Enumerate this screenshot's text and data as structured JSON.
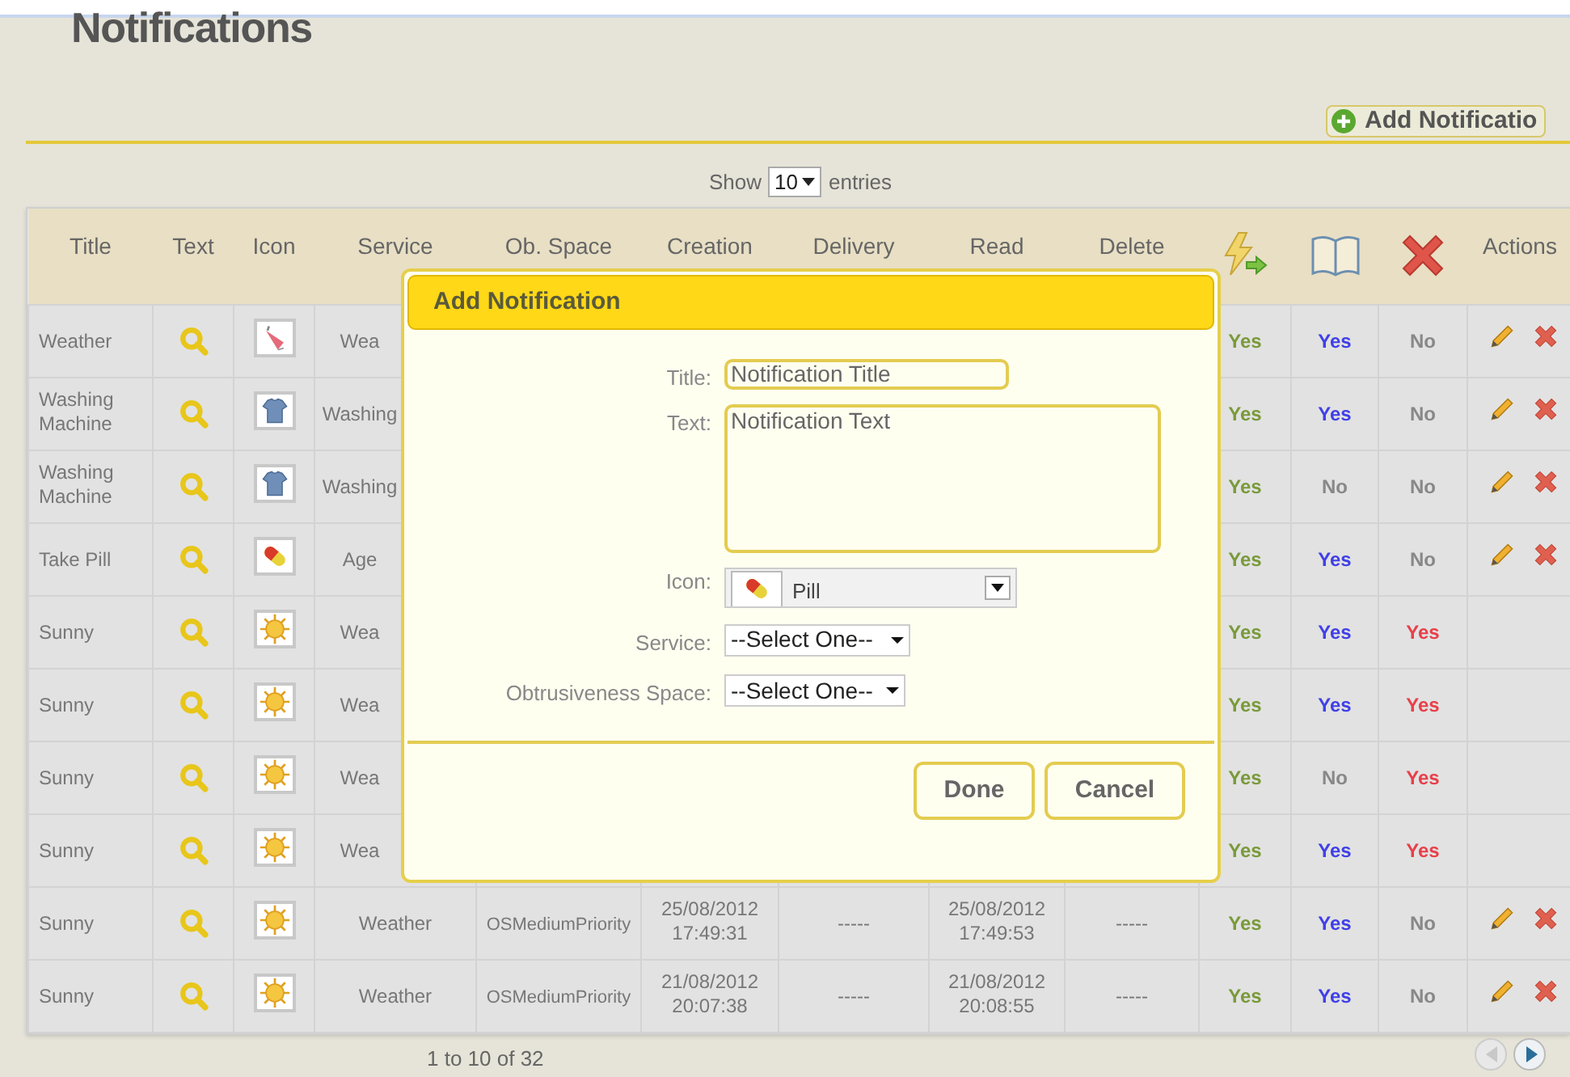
{
  "page_title": "Notifications",
  "add_button": "Add Notificatio",
  "length_menu": {
    "before": "Show",
    "value": "10",
    "after": "entries"
  },
  "table": {
    "columns": [
      {
        "kind": "text",
        "label": "Title"
      },
      {
        "kind": "text",
        "label": "Text"
      },
      {
        "kind": "text",
        "label": "Icon"
      },
      {
        "kind": "text",
        "label": "Service"
      },
      {
        "kind": "text",
        "label": "Ob. Space"
      },
      {
        "kind": "text",
        "label": "Creation"
      },
      {
        "kind": "text",
        "label": "Delivery"
      },
      {
        "kind": "text",
        "label": "Read"
      },
      {
        "kind": "text",
        "label": "Delete"
      },
      {
        "kind": "bolt"
      },
      {
        "kind": "book"
      },
      {
        "kind": "cross"
      },
      {
        "kind": "text",
        "label": "Actions"
      }
    ],
    "rows": [
      {
        "title": "Weather",
        "kind": "umbrella",
        "service": "Wea",
        "delivered": "Yes",
        "read": {
          "text": "Yes",
          "on": true
        },
        "deleted": {
          "text": "No",
          "on": false
        },
        "actions": true
      },
      {
        "title": "Washing Machine",
        "kind": "shirt",
        "service": "Washing",
        "delivered": "Yes",
        "read": {
          "text": "Yes",
          "on": true
        },
        "deleted": {
          "text": "No",
          "on": false
        },
        "actions": true
      },
      {
        "title": "Washing Machine",
        "kind": "shirt",
        "service": "Washing",
        "delivered": "Yes",
        "read": {
          "text": "No",
          "on": false
        },
        "deleted": {
          "text": "No",
          "on": false
        },
        "actions": true
      },
      {
        "title": "Take Pill",
        "kind": "pill",
        "service": "Age",
        "delivered": "Yes",
        "read": {
          "text": "Yes",
          "on": true
        },
        "deleted": {
          "text": "No",
          "on": false
        },
        "actions": true
      },
      {
        "title": "Sunny",
        "kind": "sun",
        "service": "Wea",
        "delivered": "Yes",
        "read": {
          "text": "Yes",
          "on": true
        },
        "deleted": {
          "text": "Yes",
          "on": true
        },
        "actions": false
      },
      {
        "title": "Sunny",
        "kind": "sun",
        "service": "Wea",
        "delivered": "Yes",
        "read": {
          "text": "Yes",
          "on": true
        },
        "deleted": {
          "text": "Yes",
          "on": true
        },
        "actions": false
      },
      {
        "title": "Sunny",
        "kind": "sun",
        "service": "Wea",
        "delivered": "Yes",
        "read": {
          "text": "No",
          "on": false
        },
        "deleted": {
          "text": "Yes",
          "on": true
        },
        "actions": false
      },
      {
        "title": "Sunny",
        "kind": "sun",
        "service": "Wea",
        "delivered": "Yes",
        "read": {
          "text": "Yes",
          "on": true
        },
        "deleted": {
          "text": "Yes",
          "on": true
        },
        "actions": false
      },
      {
        "title": "Sunny",
        "kind": "sun",
        "service": "Weather",
        "ob_space": "OSMediumPriority",
        "creation": "25/08/2012 17:49:31",
        "delivery": "-----",
        "read_date": "25/08/2012 17:49:53",
        "delete_date": "-----",
        "delivered": "Yes",
        "read": {
          "text": "Yes",
          "on": true
        },
        "deleted": {
          "text": "No",
          "on": false
        },
        "actions": true
      },
      {
        "title": "Sunny",
        "kind": "sun",
        "service": "Weather",
        "ob_space": "OSMediumPriority",
        "creation": "21/08/2012 20:07:38",
        "delivery": "-----",
        "read_date": "21/08/2012 20:08:55",
        "delete_date": "-----",
        "delivered": "Yes",
        "read": {
          "text": "Yes",
          "on": true
        },
        "deleted": {
          "text": "No",
          "on": false
        },
        "actions": true
      }
    ]
  },
  "info": "1 to 10 of 32",
  "dialog": {
    "title": "Add Notification",
    "fields": [
      {
        "kind": "input",
        "label": "Title:",
        "value": "Notification Title"
      },
      {
        "kind": "textarea",
        "label": "Text:",
        "value": "Notification Text"
      },
      {
        "kind": "iconselect",
        "label": "Icon:",
        "value": "Pill"
      },
      {
        "kind": "select",
        "label": "Service:",
        "value": "--Select One--"
      },
      {
        "kind": "select",
        "label": "Obtrusiveness Space:",
        "value": "--Select One--"
      }
    ],
    "buttons": [
      "Done",
      "Cancel"
    ]
  }
}
